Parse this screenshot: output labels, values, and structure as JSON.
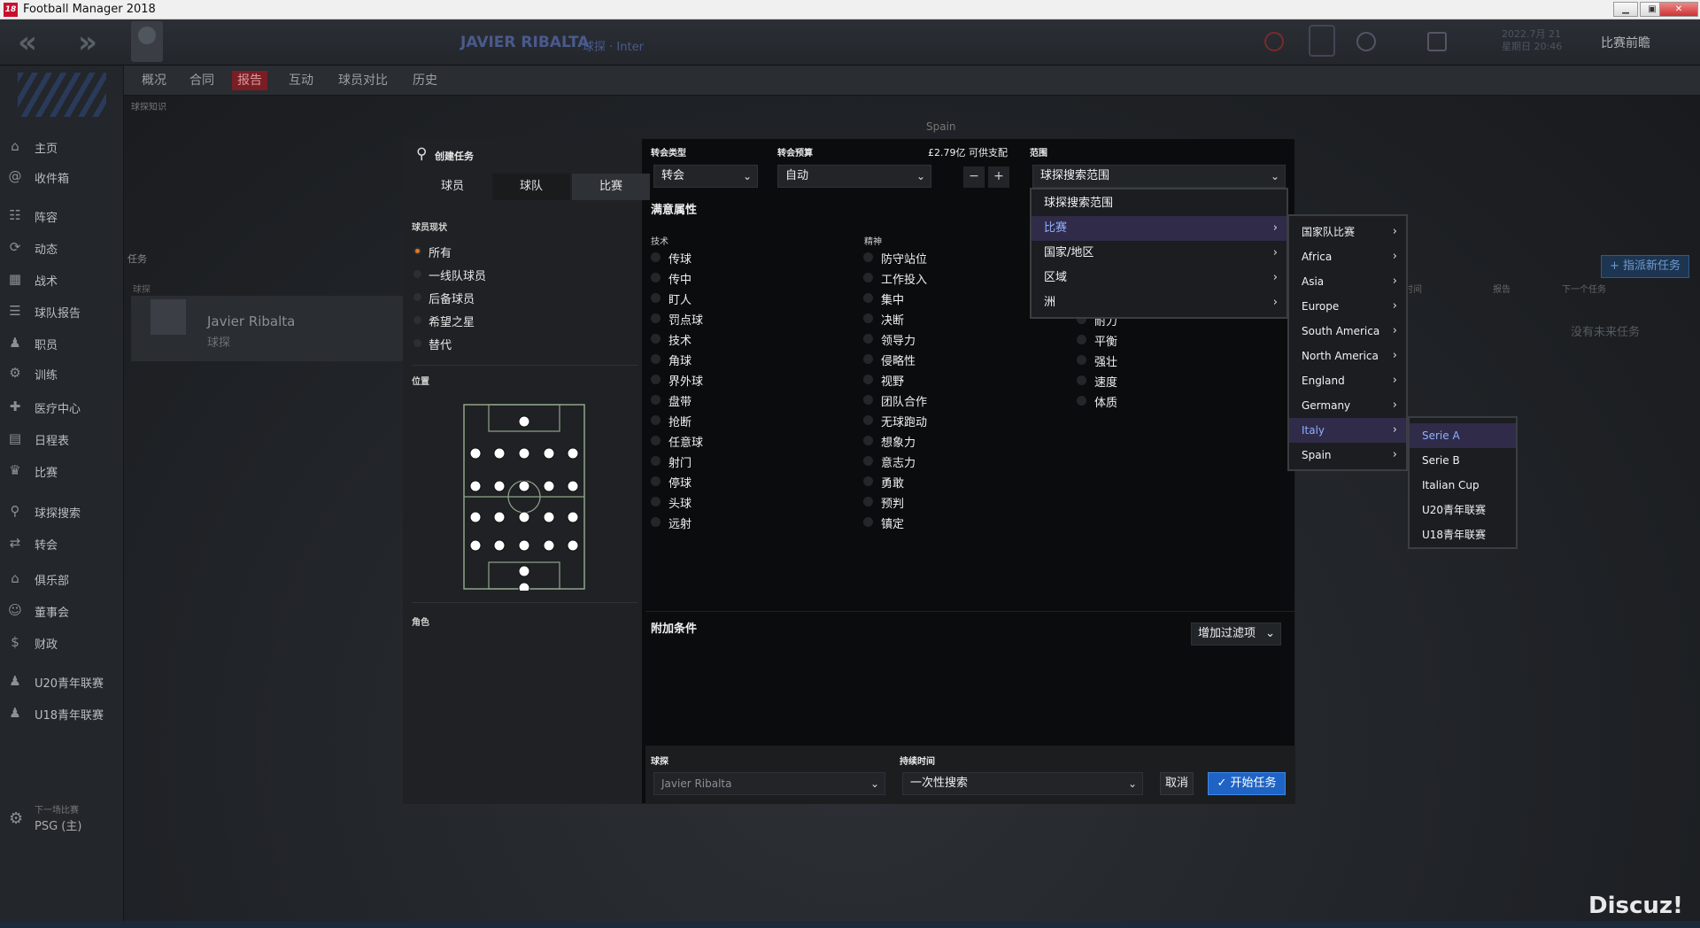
{
  "window": {
    "title": "Football Manager 2018",
    "min": "▁",
    "max": "▣",
    "close": "✕"
  },
  "header": {
    "player_name": "JAVIER RIBALTA",
    "player_role": "球探 · Inter",
    "date_line1": "2022.7月 21",
    "date_line2": "星期日 20:46",
    "continue_label": "比赛前瞻"
  },
  "subnav": {
    "tabs": [
      "概况",
      "合同",
      "报告",
      "互动",
      "球员对比",
      "历史"
    ],
    "active": 2
  },
  "breadcrumb": "球探知识",
  "sidebar": {
    "items": [
      {
        "icon": "⌂",
        "label": "主页"
      },
      {
        "icon": "@",
        "label": "收件箱"
      },
      {
        "icon": "☷",
        "label": "阵容"
      },
      {
        "icon": "⟳",
        "label": "动态"
      },
      {
        "icon": "▦",
        "label": "战术"
      },
      {
        "icon": "☰",
        "label": "球队报告"
      },
      {
        "icon": "♟",
        "label": "职员"
      },
      {
        "icon": "⚙",
        "label": "训练"
      },
      {
        "icon": "✚",
        "label": "医疗中心"
      },
      {
        "icon": "▤",
        "label": "日程表"
      },
      {
        "icon": "♛",
        "label": "比赛"
      },
      {
        "icon": "⚲",
        "label": "球探搜索"
      },
      {
        "icon": "⇄",
        "label": "转会"
      },
      {
        "icon": "⌂",
        "label": "俱乐部"
      },
      {
        "icon": "☺",
        "label": "董事会"
      },
      {
        "icon": "$",
        "label": "财政"
      },
      {
        "icon": "♟",
        "label": "U20青年联赛"
      },
      {
        "icon": "♟",
        "label": "U18青年联赛"
      }
    ],
    "next_match_label": "下一场比赛",
    "next_match_value": "PSG (主)"
  },
  "background": {
    "task_section": "任务",
    "task_sub": "球探",
    "task_name": "Javier Ribalta",
    "task_role": "球探",
    "assign_button": "+ 指派新任务",
    "no_task": "没有未来任务",
    "col_time": "时间",
    "col_report": "报告",
    "col_next": "下一个任务",
    "spain_label": "Spain"
  },
  "modal": {
    "title": "创建任务",
    "tabs": [
      "球员",
      "球队",
      "比赛"
    ],
    "selected_tab": 2,
    "player_status_label": "球员现状",
    "player_status_options": [
      "所有",
      "一线队球员",
      "后备球员",
      "希望之星",
      "替代"
    ],
    "position_label": "位置",
    "role_label": "角色",
    "transfer_type_label": "转会类型",
    "transfer_type_value": "转会",
    "budget_label": "转会预算",
    "budget_info": "£2.79亿 可供支配",
    "budget_value": "自动",
    "scope_label": "范围",
    "scope_value": "球探搜索范围",
    "attributes_title": "满意属性",
    "technical_label": "技术",
    "mental_label": "精神",
    "technical": [
      "传球",
      "传中",
      "盯人",
      "罚点球",
      "技术",
      "角球",
      "界外球",
      "盘带",
      "抢断",
      "任意球",
      "射门",
      "停球",
      "头球",
      "远射"
    ],
    "mental": [
      "防守站位",
      "工作投入",
      "集中",
      "决断",
      "领导力",
      "侵略性",
      "视野",
      "团队合作",
      "无球跑动",
      "想象力",
      "意志力",
      "勇敢",
      "预判",
      "镇定"
    ],
    "physical": [
      "耐力",
      "平衡",
      "强壮",
      "速度",
      "体质"
    ],
    "extra_title": "附加条件",
    "add_filter": "增加过滤项",
    "scout_label": "球探",
    "scout_value": "Javier Ribalta",
    "duration_label": "持续时间",
    "duration_value": "一次性搜索",
    "cancel": "取消",
    "start": "开始任务"
  },
  "dropdown_scope": [
    "球探搜索范围",
    "比赛",
    "国家/地区",
    "区域",
    "洲"
  ],
  "dropdown_comp": [
    "国家队比赛",
    "Africa",
    "Asia",
    "Europe",
    "South America",
    "North America",
    "England",
    "Germany",
    "Italy",
    "Spain"
  ],
  "dropdown_italy": [
    "Serie A",
    "Serie B",
    "Italian Cup",
    "U20青年联赛",
    "U18青年联赛"
  ],
  "watermark": "Discuz!",
  "colors": {
    "accent": "#1f64c4",
    "highlight": "#2f2b48",
    "orange_radio": "#e7771c",
    "active_tab": "#7a1e25"
  }
}
